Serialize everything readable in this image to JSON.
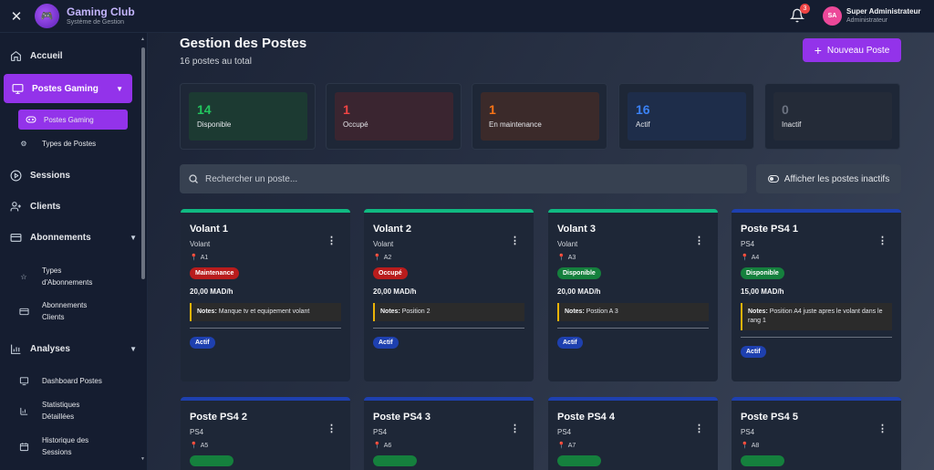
{
  "header": {
    "app_name": "Gaming Club",
    "app_subtitle": "Système de Gestion",
    "notification_count": "3",
    "user_initials": "SA",
    "user_name": "Super Administrateur",
    "user_role": "Administrateur"
  },
  "sidebar": {
    "items": [
      {
        "label": "Accueil",
        "icon": "home-icon"
      },
      {
        "label": "Postes Gaming",
        "icon": "monitor-icon",
        "active": true
      },
      {
        "label": "Postes Gaming",
        "icon": "gamepad-icon",
        "sub": true,
        "active": true
      },
      {
        "label": "Types de Postes",
        "icon": "gear-icon",
        "sub": true
      },
      {
        "label": "Sessions",
        "icon": "play-circle-icon"
      },
      {
        "label": "Clients",
        "icon": "user-plus-icon"
      },
      {
        "label": "Abonnements",
        "icon": "card-icon"
      },
      {
        "label": "Types d'Abonnements",
        "icon": "star-icon",
        "sub": true
      },
      {
        "label": "Abonnements Clients",
        "icon": "credit-card-icon",
        "sub": true
      },
      {
        "label": "Analyses",
        "icon": "bar-chart-icon"
      },
      {
        "label": "Dashboard Postes",
        "icon": "dashboard-icon",
        "sub": true
      },
      {
        "label": "Statistiques Détaillées",
        "icon": "stats-icon",
        "sub": true
      },
      {
        "label": "Historique des Sessions",
        "icon": "calendar-icon",
        "sub": true
      }
    ]
  },
  "page": {
    "title": "Gestion des Postes",
    "subtitle": "16 postes au total",
    "new_button": "Nouveau Poste",
    "search_placeholder": "Rechercher un poste...",
    "toggle_inactive": "Afficher les postes inactifs"
  },
  "stats": [
    {
      "value": "14",
      "label": "Disponible",
      "color": "#22c55e"
    },
    {
      "value": "1",
      "label": "Occupé",
      "color": "#ef4444"
    },
    {
      "value": "1",
      "label": "En maintenance",
      "color": "#f97316"
    },
    {
      "value": "16",
      "label": "Actif",
      "color": "#3b82f6"
    },
    {
      "value": "0",
      "label": "Inactif",
      "color": "#6b7280"
    }
  ],
  "posts": [
    {
      "name": "Volant 1",
      "type": "Volant",
      "location": "A1",
      "status": "Maintenance",
      "status_color": "#b91c1c",
      "price": "20,00 MAD/h",
      "notes_label": "Notes:",
      "notes": "Manque tv et equipement volant",
      "active": "Actif",
      "bar_color": "#10b981"
    },
    {
      "name": "Volant 2",
      "type": "Volant",
      "location": "A2",
      "status": "Occupé",
      "status_color": "#b91c1c",
      "price": "20,00 MAD/h",
      "notes_label": "Notes:",
      "notes": "Position 2",
      "active": "Actif",
      "bar_color": "#10b981"
    },
    {
      "name": "Volant 3",
      "type": "Volant",
      "location": "A3",
      "status": "Disponible",
      "status_color": "#15803d",
      "price": "20,00 MAD/h",
      "notes_label": "Notes:",
      "notes": "Postion A 3",
      "active": "Actif",
      "bar_color": "#10b981"
    },
    {
      "name": "Poste PS4 1",
      "type": "PS4",
      "location": "A4",
      "status": "Disponible",
      "status_color": "#15803d",
      "price": "15,00 MAD/h",
      "notes_label": "Notes:",
      "notes": "Position A4 juste apres le volant dans le rang 1",
      "active": "Actif",
      "bar_color": "#1e40af"
    },
    {
      "name": "Poste PS4 2",
      "type": "PS4",
      "location": "A5",
      "bar_color": "#1e40af"
    },
    {
      "name": "Poste PS4 3",
      "type": "PS4",
      "location": "A6",
      "bar_color": "#1e40af"
    },
    {
      "name": "Poste PS4 4",
      "type": "PS4",
      "location": "A7",
      "bar_color": "#1e40af"
    },
    {
      "name": "Poste PS4 5",
      "type": "PS4",
      "location": "A8",
      "bar_color": "#1e40af"
    }
  ]
}
